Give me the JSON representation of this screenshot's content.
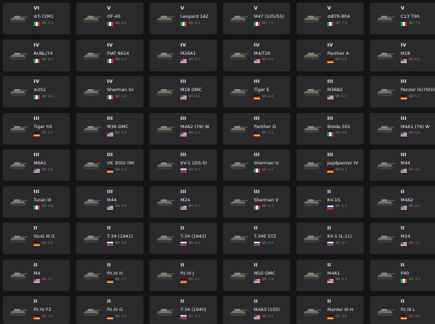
{
  "cards": [
    {
      "rank": "VI",
      "name": "⊘T-72M1",
      "country": "italy",
      "br": "BR: 9.3"
    },
    {
      "rank": "V",
      "name": "OF-40",
      "country": "italy",
      "br": "BR: 8.0"
    },
    {
      "rank": "V",
      "name": "Leopard 1A2",
      "country": "italy",
      "br": "BR: 8.0"
    },
    {
      "rank": "V",
      "name": "M47 (105/55)",
      "country": "italy",
      "br": "BR: 7.7"
    },
    {
      "rank": "V",
      "name": "⊘BTR-80A",
      "country": "italy",
      "br": "BR: 7.3"
    },
    {
      "rank": "V",
      "name": "C13 T90",
      "country": "italy",
      "br": "BR: 7.0"
    },
    {
      "rank": "IV",
      "name": "AUBL/74",
      "country": "italy",
      "br": "BR: 6.7"
    },
    {
      "rank": "IV",
      "name": "FIAT 6614",
      "country": "italy",
      "br": "BR: 6.7"
    },
    {
      "rank": "IV",
      "name": "M26A1",
      "country": "usa",
      "br": "BR: 6.7"
    },
    {
      "rank": "IV",
      "name": "M4/T26",
      "country": "usa",
      "br": "BR: 6.0"
    },
    {
      "rank": "IV",
      "name": "Panther A",
      "country": "germany",
      "br": "BR: 6.0"
    },
    {
      "rank": "IV",
      "name": "M18",
      "country": "usa",
      "br": "BR: 6.0"
    },
    {
      "rank": "IV",
      "name": "⊘2S1",
      "country": "italy",
      "br": "BR: 6.0"
    },
    {
      "rank": "IV",
      "name": "Sherman Vc",
      "country": "italy",
      "br": "BR: 5.0"
    },
    {
      "rank": "III",
      "name": "M18 GMC",
      "country": "usa",
      "br": "BR: 6.0"
    },
    {
      "rank": "III",
      "name": "Tiger E",
      "country": "germany",
      "br": "BR: 6.0"
    },
    {
      "rank": "III",
      "name": "M36B2",
      "country": "usa",
      "br": "BR: 5.7"
    },
    {
      "rank": "III",
      "name": "Panzer IV/70(V)",
      "country": "germany",
      "br": "BR: 5.7"
    },
    {
      "rank": "III",
      "name": "Tiger H1",
      "country": "germany",
      "br": "BR: 5.7"
    },
    {
      "rank": "III",
      "name": "M36 GMC",
      "country": "usa",
      "br": "BR: 5.3"
    },
    {
      "rank": "III",
      "name": "M4A2 (76) W",
      "country": "usa",
      "br": "BR: 5.3"
    },
    {
      "rank": "III",
      "name": "Panther D",
      "country": "germany",
      "br": "BR: 5.3"
    },
    {
      "rank": "III",
      "name": "Breda 501",
      "country": "italy",
      "br": "BR: 5.0"
    },
    {
      "rank": "III",
      "name": "M4A1 (76) W",
      "country": "usa",
      "br": "BR: 5.0"
    },
    {
      "rank": "III",
      "name": "M6A1",
      "country": "usa",
      "br": "BR: 5.0"
    },
    {
      "rank": "III",
      "name": "VK 3002 (M)",
      "country": "germany",
      "br": "BR: 5.0"
    },
    {
      "rank": "III",
      "name": "KV-1 (ZiS-5)",
      "country": "ussr",
      "br": "BR: 4.7"
    },
    {
      "rank": "III",
      "name": "Sherman Ic",
      "country": "italy",
      "br": "BR: 4.7"
    },
    {
      "rank": "III",
      "name": "Jagdpanzer IV",
      "country": "germany",
      "br": "BR: 4.3"
    },
    {
      "rank": "III",
      "name": "M44",
      "country": "usa",
      "br": "BR: 4.0"
    },
    {
      "rank": "III",
      "name": "Turan III",
      "country": "italy",
      "br": "BR: 4.0"
    },
    {
      "rank": "III",
      "name": "M44",
      "country": "usa",
      "br": "BR: 4.0"
    },
    {
      "rank": "III",
      "name": "M24",
      "country": "usa",
      "br": "BR: 3.7"
    },
    {
      "rank": "III",
      "name": "Sherman V",
      "country": "italy",
      "br": "BR: 3.7"
    },
    {
      "rank": "II",
      "name": "KV-1S",
      "country": "ussr",
      "br": "BR: 4.3"
    },
    {
      "rank": "II",
      "name": "M4A2",
      "country": "usa",
      "br": "BR: 4.0"
    },
    {
      "rank": "II",
      "name": "StuG III G",
      "country": "germany",
      "br": "BR: 4.0"
    },
    {
      "rank": "II",
      "name": "T-34 (1941)",
      "country": "ussr",
      "br": "BR: 4.0"
    },
    {
      "rank": "II",
      "name": "T-34 (1942)",
      "country": "ussr",
      "br": "BR: 4.0"
    },
    {
      "rank": "II",
      "name": "T-34E STZ",
      "country": "ussr",
      "br": "BR: 4.0"
    },
    {
      "rank": "II",
      "name": "KV-1 (L-11)",
      "country": "ussr",
      "br": "BR: 3.7"
    },
    {
      "rank": "II",
      "name": "M24",
      "country": "usa",
      "br": "BR: 3.7"
    },
    {
      "rank": "II",
      "name": "M4",
      "country": "usa",
      "br": "BR: 3.7"
    },
    {
      "rank": "II",
      "name": "Pz.IV H",
      "country": "germany",
      "br": "BR: 3.7"
    },
    {
      "rank": "II",
      "name": "Pz.IV J",
      "country": "germany",
      "br": "BR: 3.7"
    },
    {
      "rank": "II",
      "name": "M10 GMC",
      "country": "usa",
      "br": "BR: 3.3"
    },
    {
      "rank": "II",
      "name": "M4A1",
      "country": "usa",
      "br": "BR: 3.3"
    },
    {
      "rank": "II",
      "name": "P40",
      "country": "italy",
      "br": "BR: 3.3"
    },
    {
      "rank": "II",
      "name": "Pz.IV F2",
      "country": "germany",
      "br": "BR: 3.3"
    },
    {
      "rank": "II",
      "name": "Pz.IV G",
      "country": "germany",
      "br": "BR: 3.3"
    },
    {
      "rank": "II",
      "name": "T-34 (1940)",
      "country": "ussr",
      "br": "BR: 3.3"
    },
    {
      "rank": "II",
      "name": "M4A3 (105)",
      "country": "usa",
      "br": "BR: 3.0"
    },
    {
      "rank": "II",
      "name": "Marder III H",
      "country": "germany",
      "br": "BR: 3.0"
    },
    {
      "rank": "II",
      "name": "Pz.III L",
      "country": "germany",
      "br": "BR: 3.0"
    }
  ]
}
